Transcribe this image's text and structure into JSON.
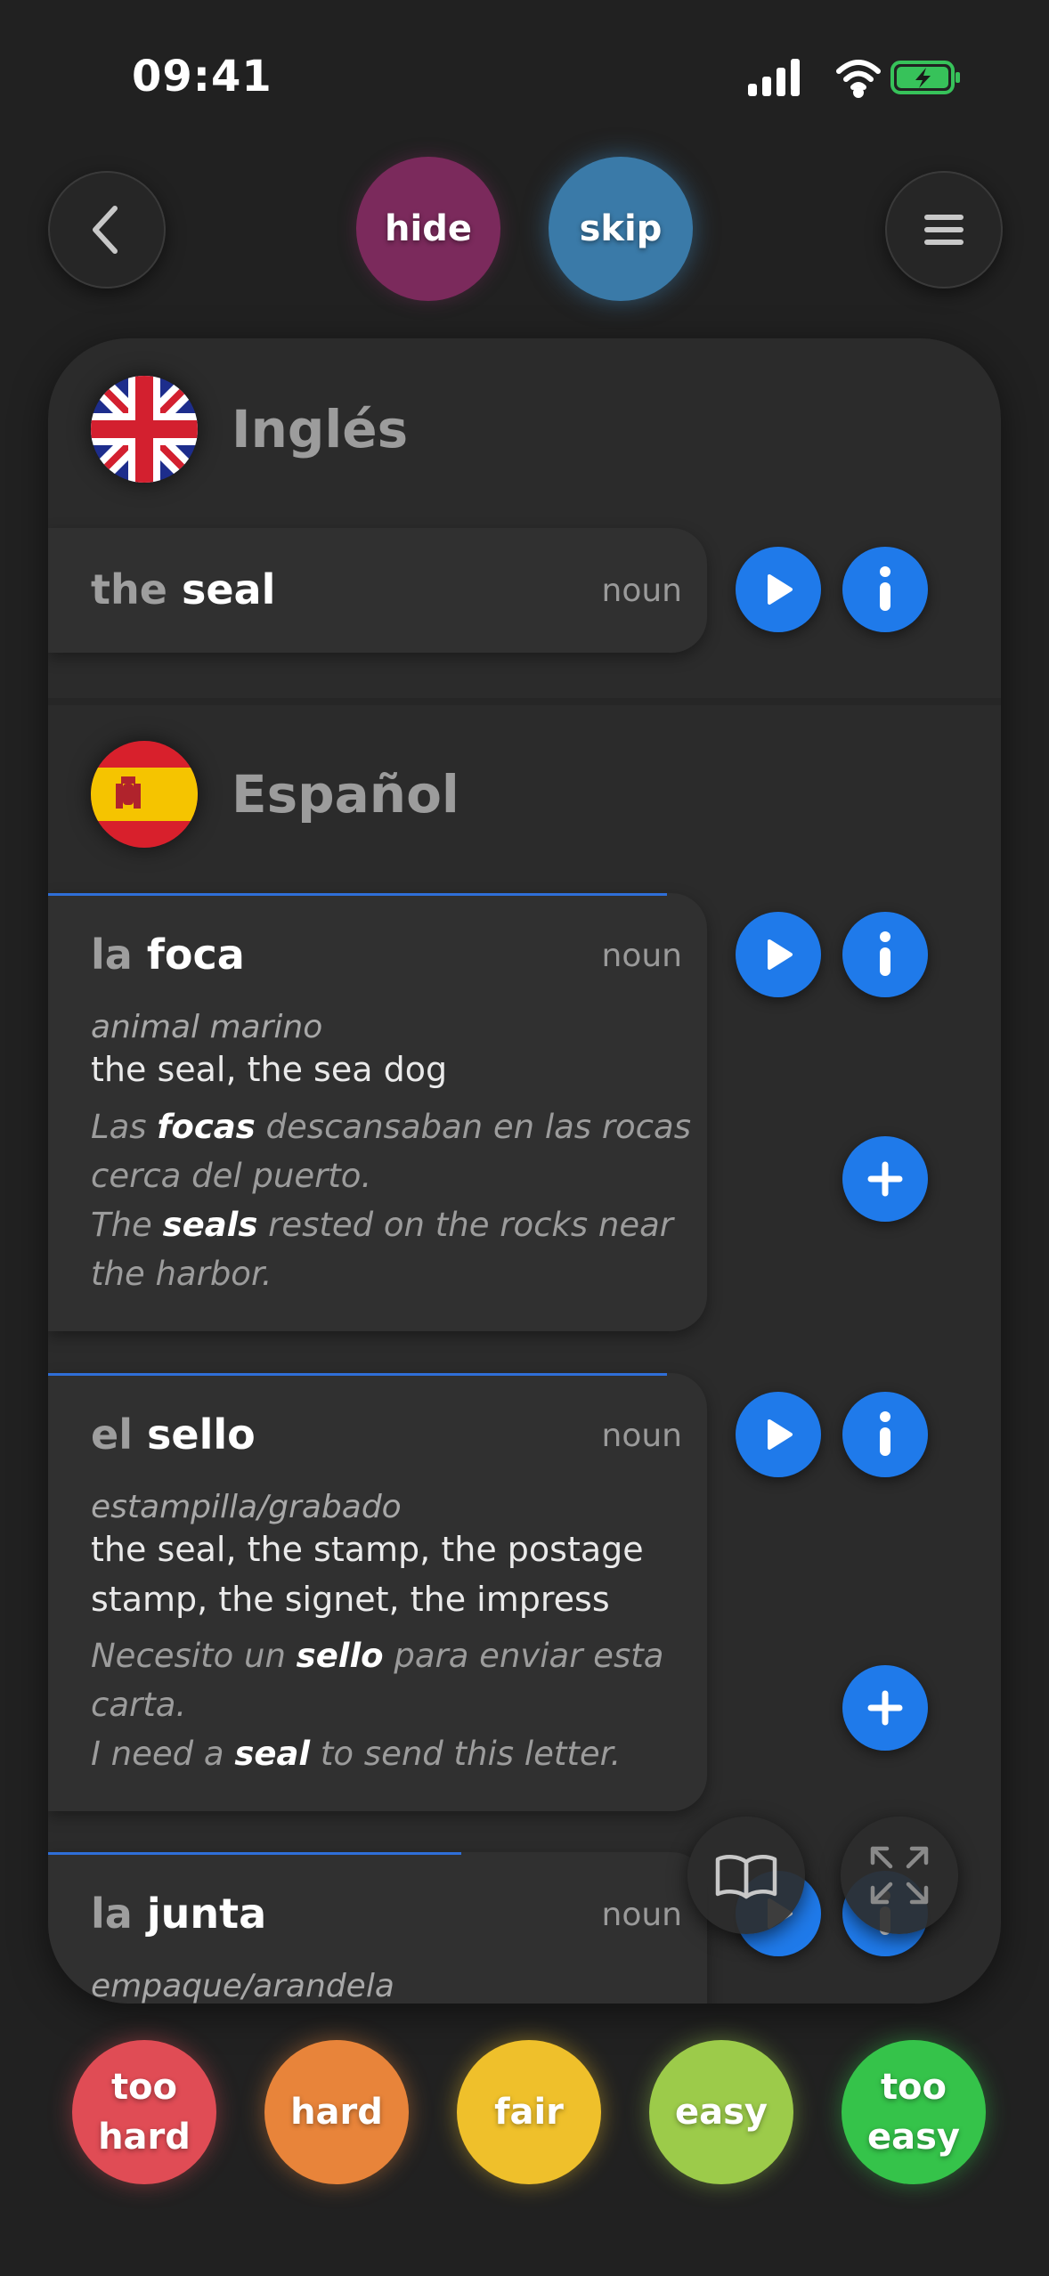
{
  "status": {
    "time": "09:41"
  },
  "top": {
    "hide_label": "hide",
    "skip_label": "skip"
  },
  "source": {
    "language": "Inglés",
    "entry": {
      "article": "the",
      "word": "seal",
      "pos": "noun"
    }
  },
  "target": {
    "language": "Español",
    "entries": [
      {
        "article": "la",
        "word": "foca",
        "pos": "noun",
        "category": "animal marino",
        "translations": "the seal, the sea dog",
        "example_es": {
          "before": "Las ",
          "bold": "focas",
          "after": " descansaban en las rocas cerca del puerto."
        },
        "example_en": {
          "before": "The ",
          "bold": "seals",
          "after": " rested on the rocks near the harbor."
        }
      },
      {
        "article": "el",
        "word": "sello",
        "pos": "noun",
        "category": "estampilla/grabado",
        "translations": "the seal, the stamp, the postage stamp, the signet, the impress",
        "example_es": {
          "before": "Necesito un ",
          "bold": "sello",
          "after": " para enviar esta carta."
        },
        "example_en": {
          "before": "I need a ",
          "bold": "seal",
          "after": " to send this letter."
        }
      },
      {
        "article": "la",
        "word": "junta",
        "pos": "noun",
        "category": "empaque/arandela"
      }
    ]
  },
  "ratings": [
    {
      "line1": "too",
      "line2": "hard",
      "color": "#e04c55"
    },
    {
      "line1": "hard",
      "line2": "",
      "color": "#e8843a"
    },
    {
      "line1": "fair",
      "line2": "",
      "color": "#efc02b"
    },
    {
      "line1": "easy",
      "line2": "",
      "color": "#9ccb4a"
    },
    {
      "line1": "too",
      "line2": "easy",
      "color": "#35c34a"
    }
  ],
  "colors": {
    "accent": "#1f7aea",
    "background": "#212121",
    "card": "#2b2b2b"
  },
  "icons": [
    "back-icon",
    "menu-icon",
    "play-icon",
    "info-icon",
    "add-icon",
    "book-icon",
    "expand-icon",
    "signal-icon",
    "wifi-icon",
    "battery-icon"
  ]
}
